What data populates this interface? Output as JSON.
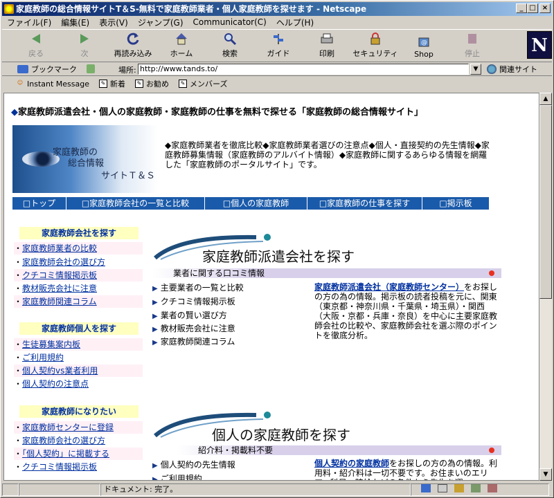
{
  "window": {
    "title": "家庭教師の総合情報サイトT＆S-無料で家庭教師業者・個人家庭教師を探せます - Netscape"
  },
  "menubar": [
    "ファイル(F)",
    "編集(E)",
    "表示(V)",
    "ジャンプ(G)",
    "Communicator(C)",
    "ヘルプ(H)"
  ],
  "nav_toolbar": {
    "back": "戻る",
    "forward": "次",
    "reload": "再読み込み",
    "home": "ホーム",
    "search": "検索",
    "guide": "ガイド",
    "print": "印刷",
    "security": "セキュリティ",
    "shop": "Shop",
    "stop": "停止"
  },
  "location": {
    "bookmarks": "ブックマーク",
    "label": "場所:",
    "url": "http://www.tands.to/",
    "related": "関連サイト"
  },
  "personal_toolbar": [
    "Instant Message",
    "新着",
    "お勧め",
    "メンバーズ"
  ],
  "page": {
    "headline_marker": "◆",
    "headline": "家庭教師派遣会社・個人の家庭教師・家庭教師の仕事を無料で探せる「家庭教師の総合情報サイト」",
    "logo": {
      "line1": "家庭教師の",
      "line2": "総合情報",
      "line3": "サイトＴ＆Ｓ"
    },
    "intro": "◆家庭教師業者を徹底比較◆家庭教師業者選びの注意点◆個人・直接契約の先生情報◆家庭教師募集情報（家庭教師のアルバイト情報）◆家庭教師に関するあらゆる情報を網羅した「家庭教師のポータルサイト」です。",
    "nav": [
      "□トップ",
      "□家庭教師会社の一覧と比較",
      "□個人の家庭教師",
      "□家庭教師の仕事を探す",
      "□掲示板"
    ],
    "sidebar": [
      {
        "title": "家庭教師会社を探す",
        "links": [
          "家庭教師業者の比較",
          "家庭教師会社の選び方",
          "クチコミ情報掲示板",
          "教材販売会社に注意",
          "家庭教師関連コラム"
        ]
      },
      {
        "title": "家庭教師個人を探す",
        "links": [
          "生徒募集案内板",
          "ご利用規約",
          "個人契約vs業者利用",
          "個人契約の注意点"
        ]
      },
      {
        "title": "家庭教師になりたい",
        "links": [
          "家庭教師センターに登録",
          "家庭教師会社の選び方",
          "「個人契約」に掲載する",
          "クチコミ情報掲示板"
        ]
      }
    ],
    "section1": {
      "title": "家庭教師派遣会社を探す",
      "sub": "業者に関する口コミ情報",
      "links": [
        "主要業者の一覧と比較",
        "クチコミ情報掲示板",
        "業者の賢い選び方",
        "教材販売会社に注意",
        "家庭教師関連コラム"
      ],
      "desc_bold": "家庭教師派遣会社（家庭教師センター）",
      "desc": "をお探しの方の為の情報。掲示板の読者投稿を元に、関東（東京都・神奈川県・千葉県・埼玉県）・関西（大阪・京都・兵庫・奈良）を中心に主要家庭教師会社の比較や、家庭教師会社を選ぶ際のポイントを徹底分析。"
    },
    "section2": {
      "title": "個人の家庭教師を探す",
      "sub": "紹介料・掲載料不要",
      "links": [
        "個人契約の先生情報",
        "ご利用規約"
      ],
      "desc_bold": "個人契約の家庭教師",
      "desc": "をお探しの方の為の情報。利用料・紹介料は一切不要です。お住まいのエリア、科目、時給などの条件から先生を選"
    }
  },
  "status": {
    "text": "ドキュメント: 完了。"
  },
  "colors": {
    "titlebar": "#0a246a",
    "nav_strip": "#1a5aaa",
    "link": "#0030a0",
    "sidebar_title_bg": "#ffffc0",
    "sidebar_link_bg": "#fff0f6"
  }
}
